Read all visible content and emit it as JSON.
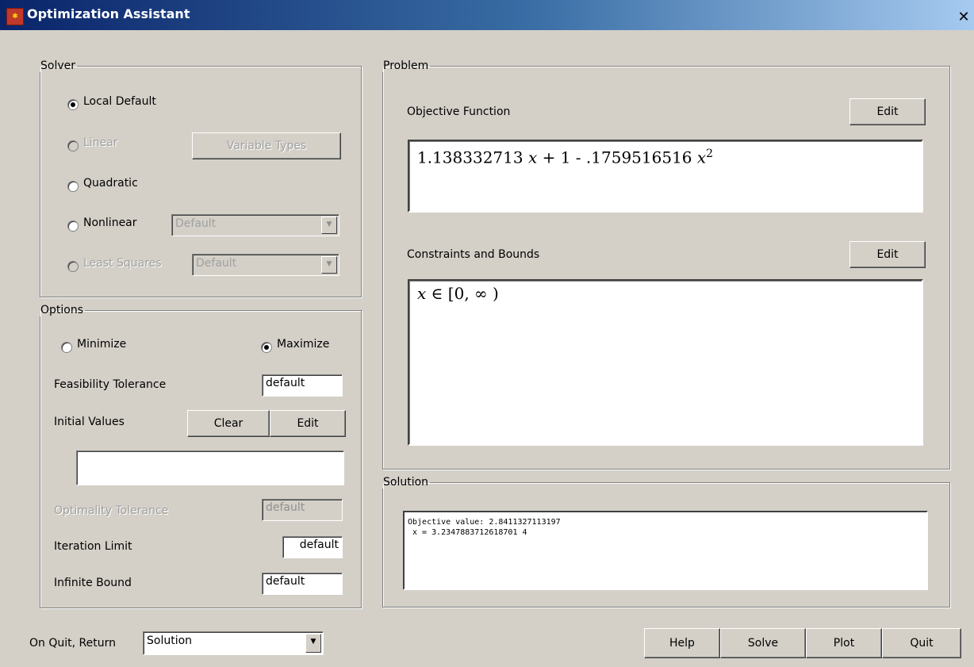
{
  "window": {
    "title": "Optimization Assistant",
    "icon": "maple-leaf-icon",
    "close_glyph": "✕"
  },
  "solver": {
    "legend": "Solver",
    "options": [
      {
        "label": "Local Default",
        "selected": true,
        "enabled": true
      },
      {
        "label": "Linear",
        "selected": false,
        "enabled": false
      },
      {
        "label": "Quadratic",
        "selected": false,
        "enabled": true
      },
      {
        "label": "Nonlinear",
        "selected": false,
        "enabled": true
      },
      {
        "label": "Least Squares",
        "selected": false,
        "enabled": false
      }
    ],
    "variable_types_label": "Variable Types",
    "nonlinear_method": "Default",
    "least_squares_method": "Default"
  },
  "options": {
    "legend": "Options",
    "minimize_label": "Minimize",
    "maximize_label": "Maximize",
    "goal": "Maximize",
    "feasibility_label": "Feasibility Tolerance",
    "feasibility_value": "default",
    "initial_values_label": "Initial Values",
    "clear_label": "Clear",
    "edit_label": "Edit",
    "initial_values_value": "",
    "optimality_label": "Optimality Tolerance",
    "optimality_value": "default",
    "iteration_label": "Iteration Limit",
    "iteration_value": "default",
    "infinite_label": "Infinite Bound",
    "infinite_value": "default"
  },
  "problem": {
    "legend": "Problem",
    "objective_label": "Objective Function",
    "objective_edit": "Edit",
    "objective_expr": {
      "coef1": "1.138332713",
      "var": "x",
      "rest": " + 1 - .1759516516 ",
      "var2": "x",
      "exp": "2"
    },
    "constraints_label": "Constraints and Bounds",
    "constraints_edit": "Edit",
    "constraints_expr": {
      "var": "x",
      "rest": " ∈ [0, ∞ )"
    }
  },
  "solution": {
    "legend": "Solution",
    "line1": "Objective value: 2.8411327113197",
    "line2": " x = 3.2347883712618701 4"
  },
  "bottom": {
    "on_quit_label": "On Quit, Return",
    "on_quit_value": "Solution",
    "help": "Help",
    "solve": "Solve",
    "plot": "Plot",
    "quit": "Quit"
  }
}
